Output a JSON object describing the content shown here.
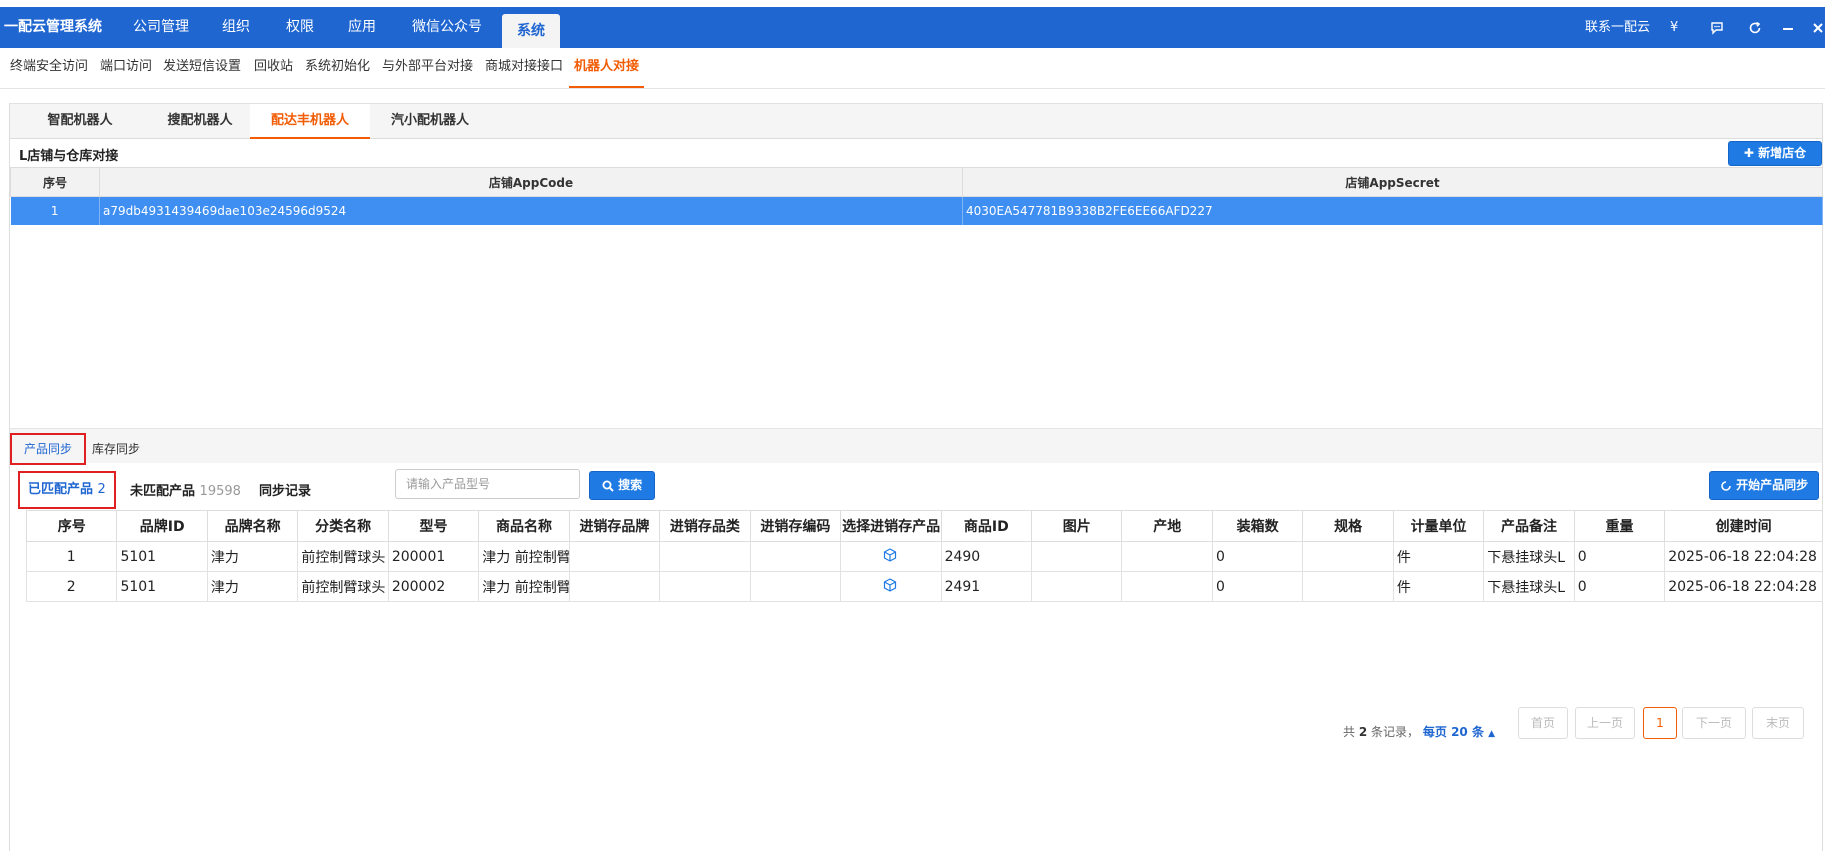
{
  "topbar": {
    "app_title": "一配云管理系统",
    "nav": [
      "公司管理",
      "组织",
      "权限",
      "应用",
      "微信公众号",
      "系统"
    ],
    "active_nav": "系统",
    "contact": "联系一配云",
    "currency_symbol": "¥"
  },
  "subnav": {
    "items": [
      "终端安全访问",
      "端口访问",
      "发送短信设置",
      "回收站",
      "系统初始化",
      "与外部平台对接",
      "商城对接接口",
      "机器人对接"
    ],
    "active": "机器人对接"
  },
  "robot_tabs": {
    "items": [
      "智配机器人",
      "搜配机器人",
      "配达丰机器人",
      "汽小配机器人"
    ],
    "active": "配达丰机器人"
  },
  "store_section": {
    "title": "L店铺与仓库对接",
    "add_button": "新增店仓",
    "columns": [
      "序号",
      "店铺AppCode",
      "店铺AppSecret"
    ],
    "rows": [
      {
        "no": "1",
        "app_code": "a79db4931439469dae103e24596d9524",
        "app_secret": "4030EA547781B9338B2FE6EE66AFD227"
      }
    ]
  },
  "sync_tabs": {
    "items": [
      "产品同步",
      "库存同步"
    ],
    "active": "产品同步"
  },
  "filters": {
    "matched_label": "已匹配产品",
    "matched_count": "2",
    "unmatched_label": "未匹配产品",
    "unmatched_count": "19598",
    "sync_log": "同步记录",
    "search_placeholder": "请输入产品型号",
    "search_button": "搜索",
    "start_sync_button": "开始产品同步"
  },
  "product_table": {
    "columns": [
      "序号",
      "品牌ID",
      "品牌名称",
      "分类名称",
      "型号",
      "商品名称",
      "进销存品牌",
      "进销存品类",
      "进销存编码",
      "选择进销存产品",
      "商品ID",
      "图片",
      "产地",
      "装箱数",
      "规格",
      "计量单位",
      "产品备注",
      "重量",
      "创建时间"
    ],
    "rows": [
      [
        "1",
        "5101",
        "津力",
        "前控制臂球头",
        "200001",
        "津力 前控制臂",
        "",
        "",
        "",
        "",
        "2490",
        "",
        "",
        "0",
        "",
        "件",
        "下悬挂球头L",
        "0",
        "2025-06-18 22:04:28"
      ],
      [
        "2",
        "5101",
        "津力",
        "前控制臂球头",
        "200002",
        "津力 前控制臂",
        "",
        "",
        "",
        "",
        "2491",
        "",
        "",
        "0",
        "",
        "件",
        "下悬挂球头L",
        "0",
        "2025-06-18 22:04:28"
      ]
    ]
  },
  "pager": {
    "total_prefix": "共",
    "total": "2",
    "total_suffix": "条记录，",
    "per_page_prefix": "每页",
    "per_page": "20",
    "per_page_suffix": "条",
    "first": "首页",
    "prev": "上一页",
    "current": "1",
    "next": "下一页",
    "last": "末页"
  },
  "colors": {
    "primary": "#1f66d1",
    "accent_orange": "#f25c05",
    "selected_row": "#3f8ff2",
    "highlight_border": "#e02020"
  }
}
